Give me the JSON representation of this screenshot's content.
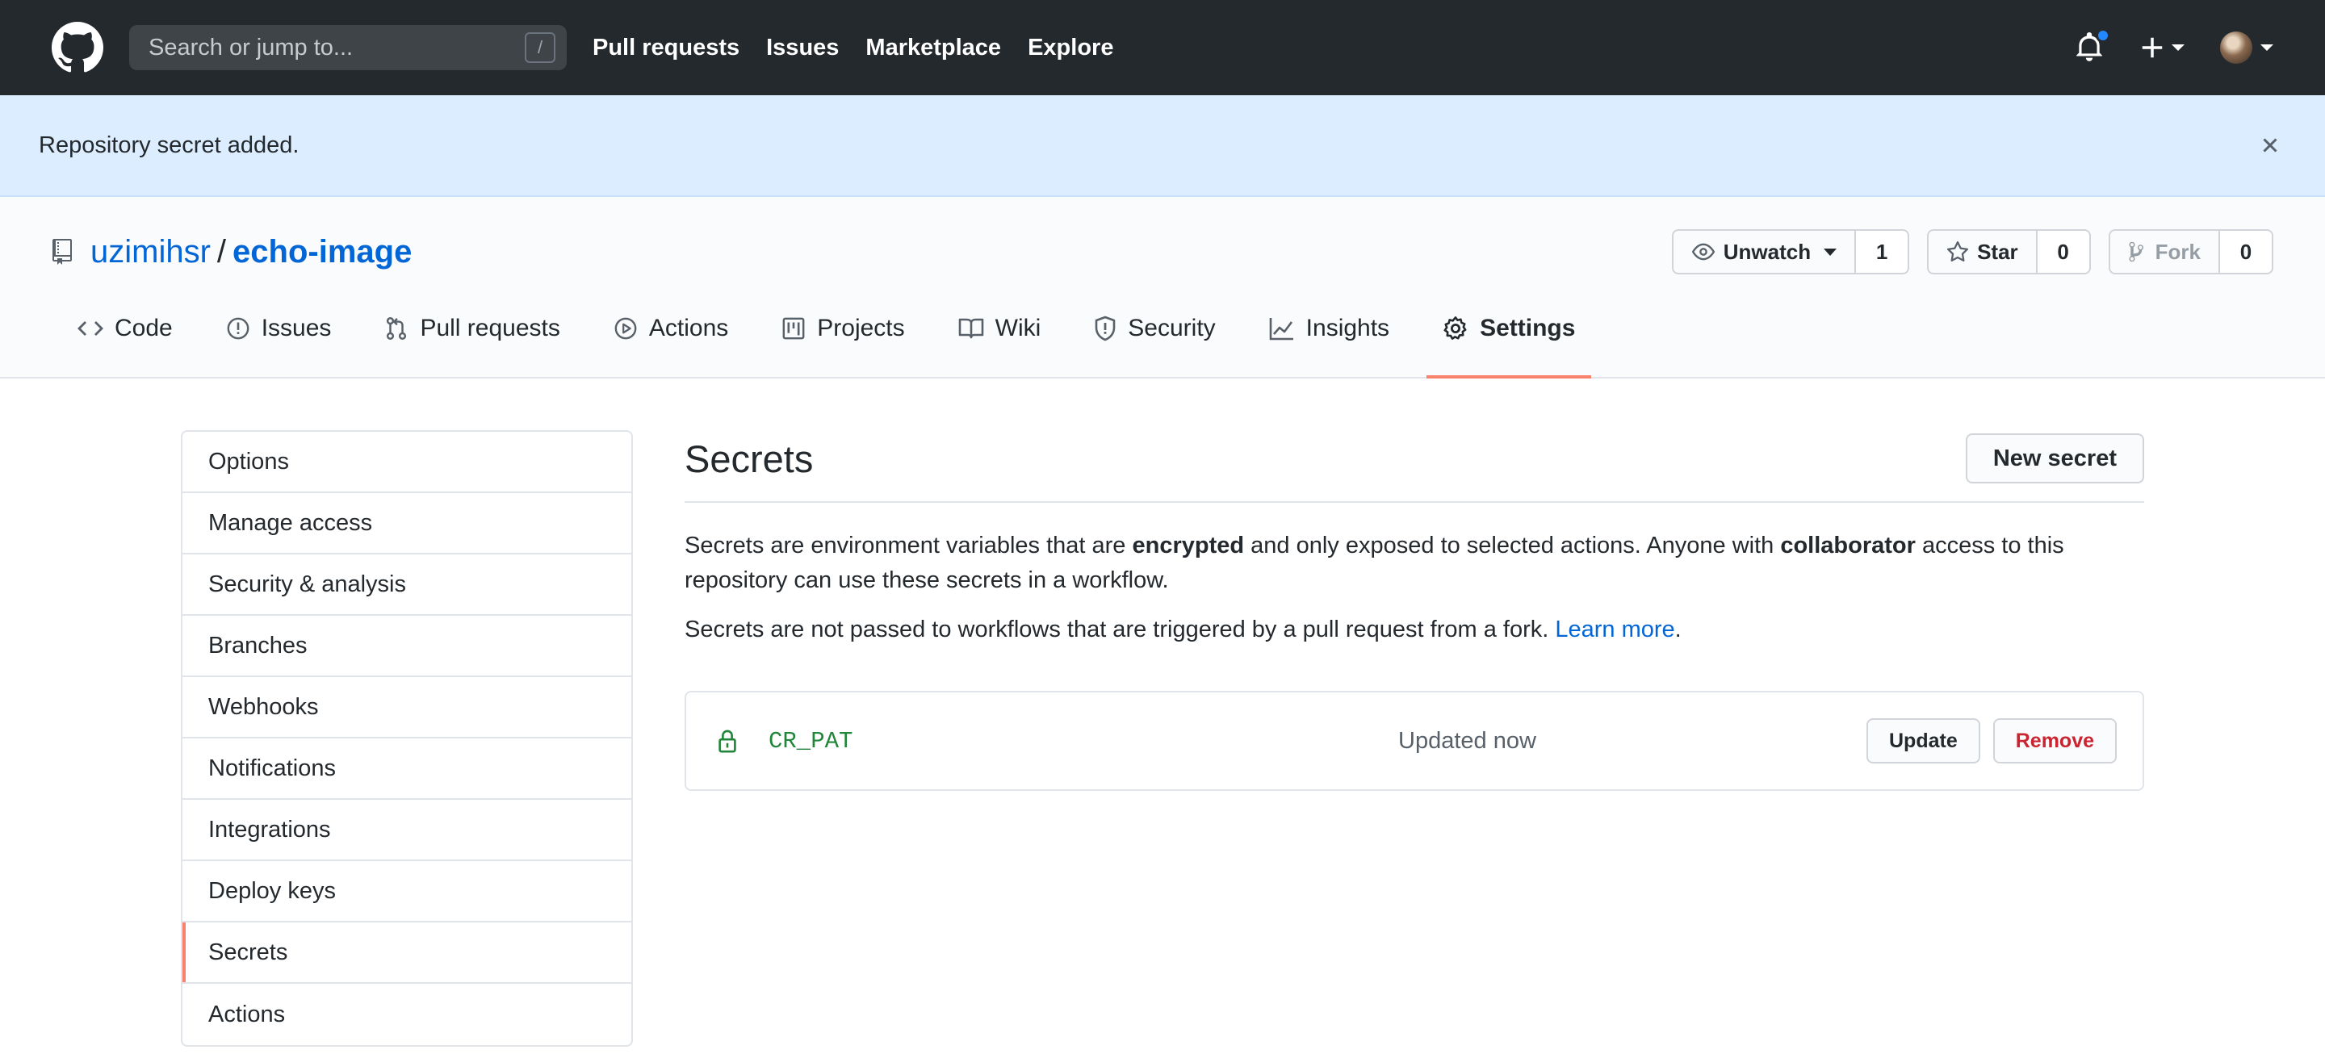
{
  "header": {
    "search_placeholder": "Search or jump to...",
    "search_shortcut": "/",
    "nav": [
      "Pull requests",
      "Issues",
      "Marketplace",
      "Explore"
    ]
  },
  "flash": {
    "message": "Repository secret added."
  },
  "repo": {
    "owner": "uzimihsr",
    "separator": "/",
    "name": "echo-image",
    "watch_label": "Unwatch",
    "watch_count": "1",
    "star_label": "Star",
    "star_count": "0",
    "fork_label": "Fork",
    "fork_count": "0"
  },
  "tabs": [
    {
      "label": "Code",
      "icon": "code-icon"
    },
    {
      "label": "Issues",
      "icon": "issue-icon"
    },
    {
      "label": "Pull requests",
      "icon": "pull-request-icon"
    },
    {
      "label": "Actions",
      "icon": "play-icon"
    },
    {
      "label": "Projects",
      "icon": "project-icon"
    },
    {
      "label": "Wiki",
      "icon": "book-icon"
    },
    {
      "label": "Security",
      "icon": "shield-icon"
    },
    {
      "label": "Insights",
      "icon": "graph-icon"
    },
    {
      "label": "Settings",
      "icon": "gear-icon",
      "selected": true
    }
  ],
  "settings_menu": [
    "Options",
    "Manage access",
    "Security & analysis",
    "Branches",
    "Webhooks",
    "Notifications",
    "Integrations",
    "Deploy keys",
    "Secrets",
    "Actions"
  ],
  "selected_menu": "Secrets",
  "secrets": {
    "title": "Secrets",
    "new_button": "New secret",
    "desc1_a": "Secrets are environment variables that are ",
    "desc1_b": "encrypted",
    "desc1_c": " and only exposed to selected actions. Anyone with ",
    "desc1_d": "collaborator",
    "desc1_e": " access to this repository can use these secrets in a workflow.",
    "desc2_a": "Secrets are not passed to workflows that are triggered by a pull request from a fork. ",
    "desc2_link": "Learn more",
    "desc2_end": ".",
    "items": [
      {
        "name": "CR_PAT",
        "updated": "Updated now",
        "update_label": "Update",
        "remove_label": "Remove"
      }
    ]
  },
  "colors": {
    "header_bg": "#24292e",
    "flash_bg": "#dbedff",
    "link": "#0366d6",
    "tab_underline": "#f9826c",
    "secret_green": "#22863a",
    "danger": "#cb2431"
  }
}
